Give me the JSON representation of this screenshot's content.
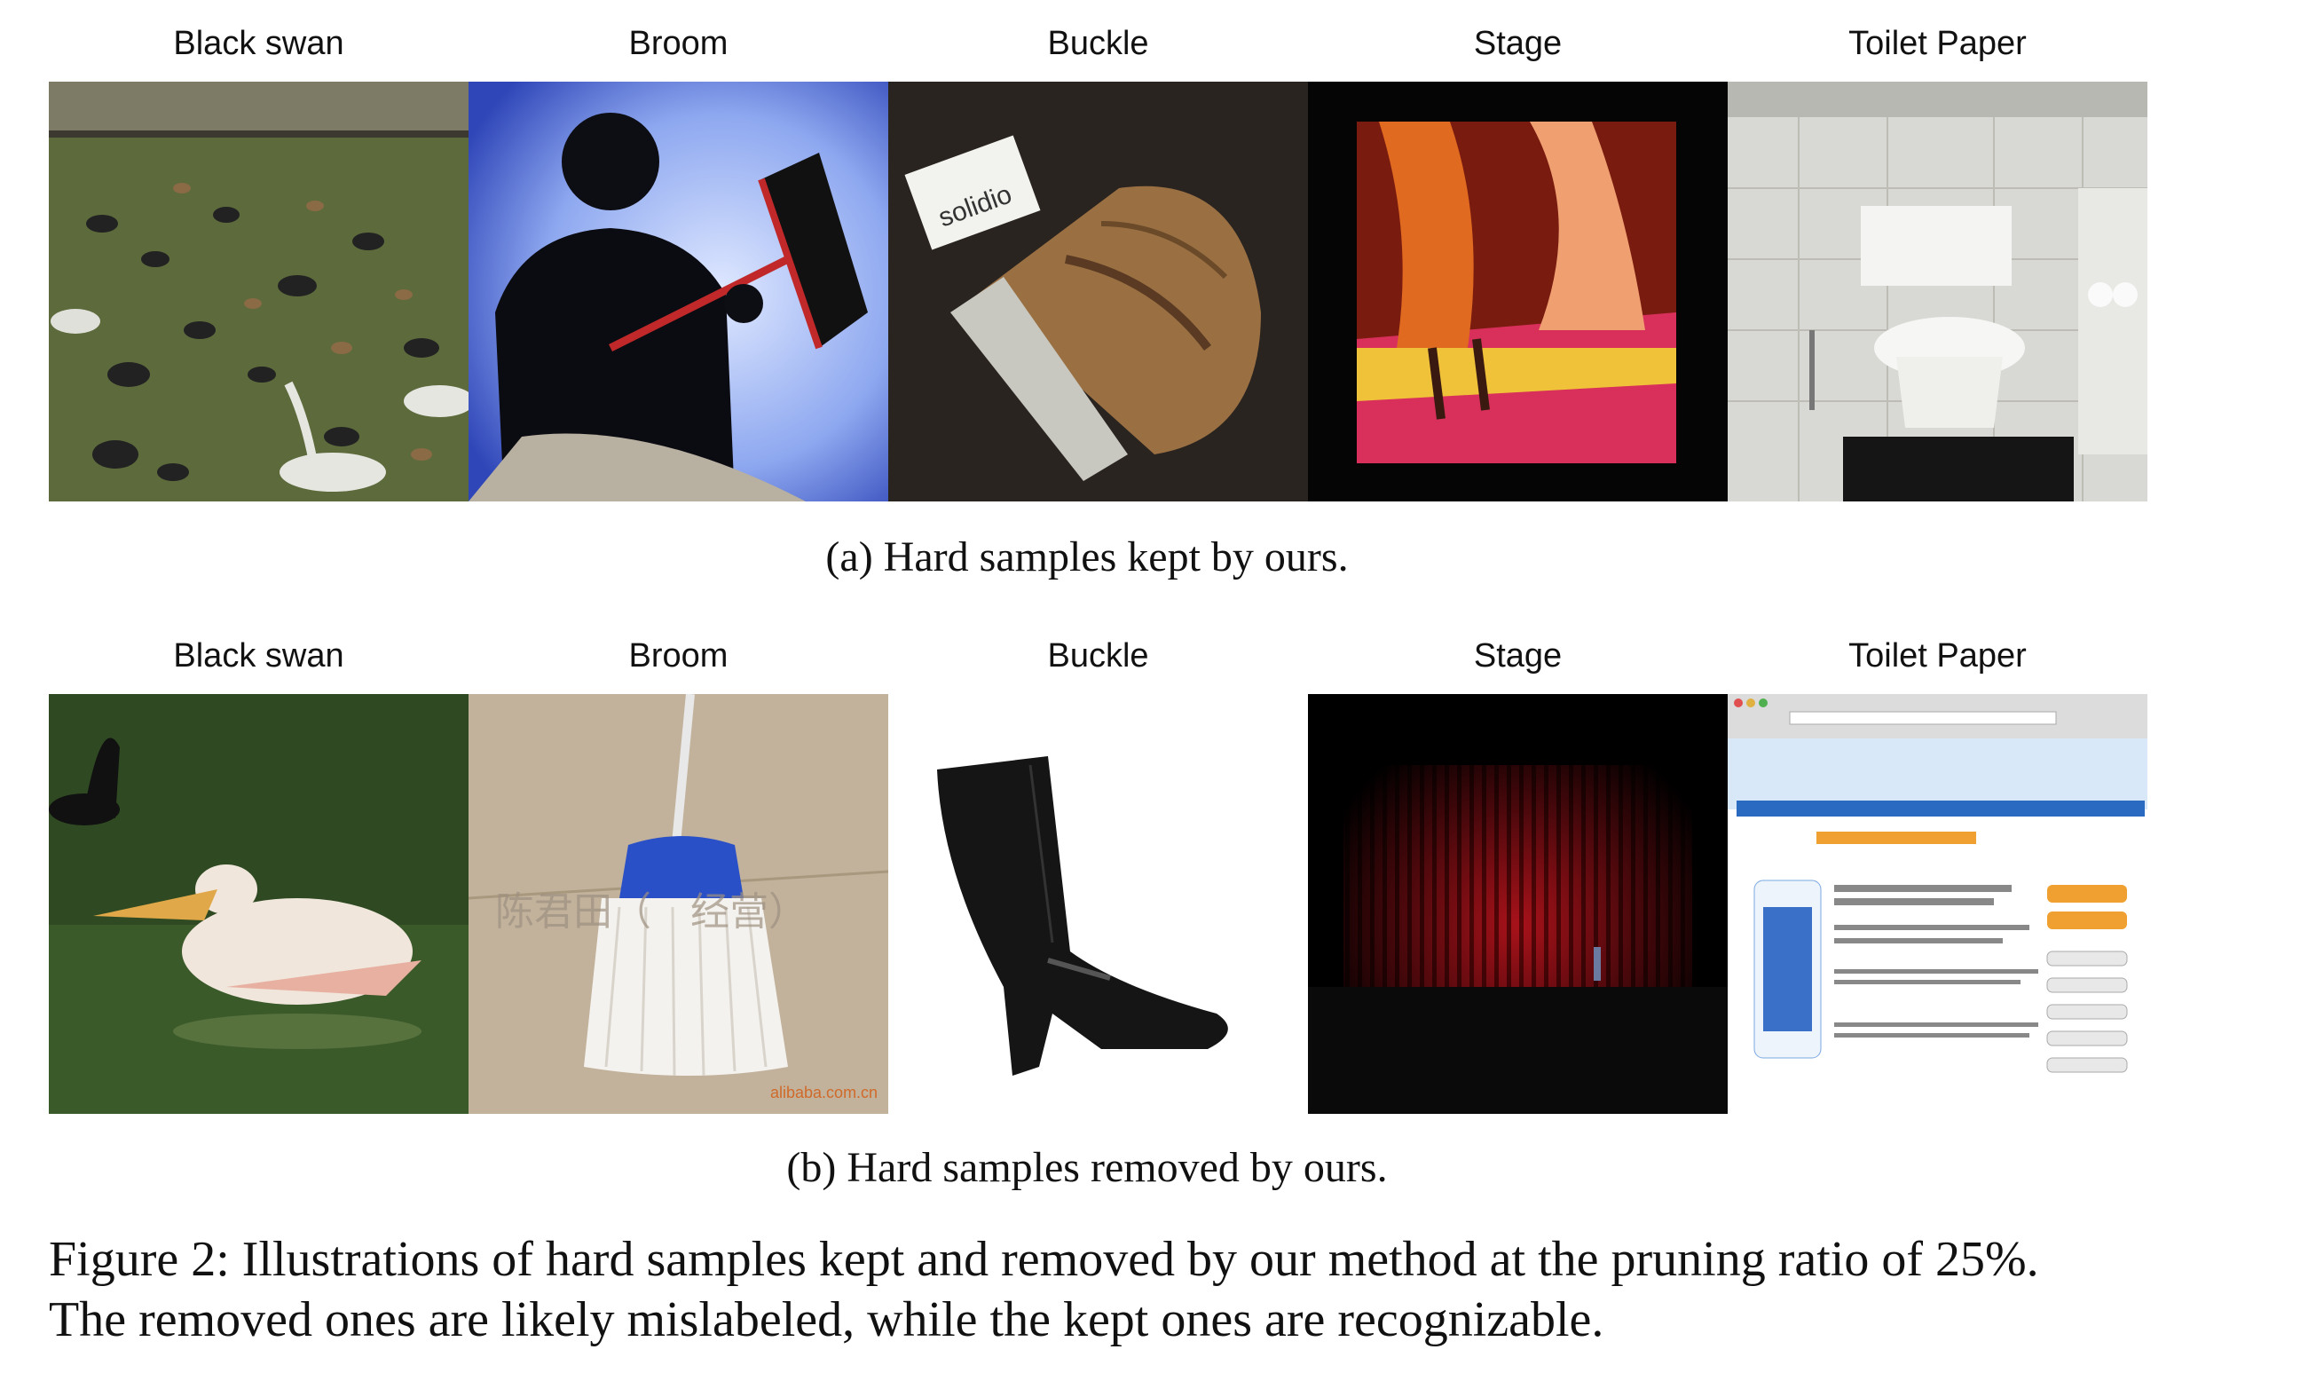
{
  "panel_a": {
    "labels": [
      "Black swan",
      "Broom",
      "Buckle",
      "Stage",
      "Toilet Paper"
    ],
    "caption": "(a) Hard samples kept by ours.",
    "tag_text": "solidio"
  },
  "panel_b": {
    "labels": [
      "Black swan",
      "Broom",
      "Buckle",
      "Stage",
      "Toilet Paper"
    ],
    "caption": "(b) Hard samples removed by ours.",
    "watermark": "陈君田（　经营）",
    "site_mark": "alibaba.com.cn"
  },
  "figure_caption": {
    "line1": "Figure 2: Illustrations of hard samples kept and removed by our method at the pruning ratio of 25%.",
    "line2": "The removed ones are likely mislabeled, while the kept ones are recognizable."
  }
}
